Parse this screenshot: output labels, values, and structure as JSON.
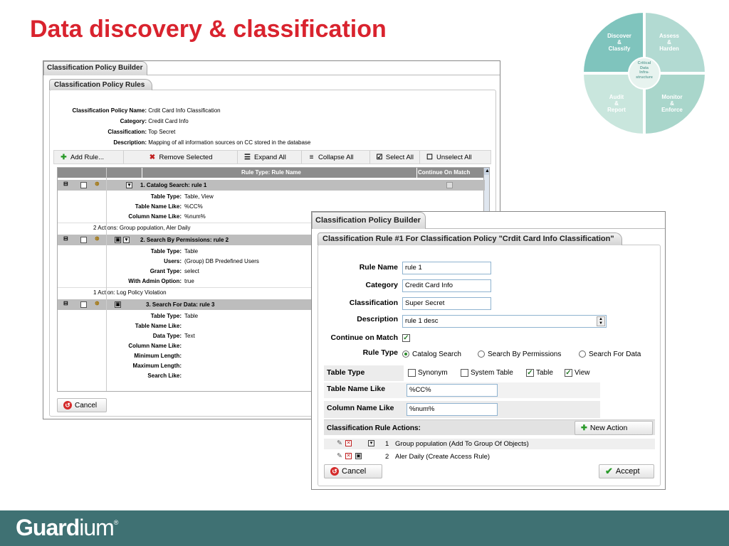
{
  "slide": {
    "title": "Data discovery & classification",
    "brand": {
      "strong": "Guard",
      "light": "ium",
      "mark": "®"
    }
  },
  "wheel": {
    "q1": [
      "Discover",
      "&",
      "Classify"
    ],
    "q2": [
      "Assess",
      "&",
      "Harden"
    ],
    "q3": [
      "Audit",
      "&",
      "Report"
    ],
    "q4": [
      "Monitor",
      "&",
      "Enforce"
    ],
    "center": [
      "Critical",
      "Data",
      "Infra-",
      "structure"
    ]
  },
  "policy_builder": {
    "tab": "Classification Policy Builder",
    "panel_tab": "Classification Policy Rules",
    "fields": [
      {
        "label": "Classification Policy Name:",
        "value": "Crdit Card Info Classification"
      },
      {
        "label": "Category:",
        "value": "Credit Card Info"
      },
      {
        "label": "Classification:",
        "value": "Top Secret"
      },
      {
        "label": "Description:",
        "value": "Mapping of all information sources on CC stored in the database"
      }
    ],
    "toolbar": {
      "add_rule": "Add Rule...",
      "remove_selected": "Remove Selected",
      "expand_all": "Expand All",
      "collapse_all": "Collapse All",
      "select_all": "Select All",
      "unselect_all": "Unselect All"
    },
    "grid": {
      "col_rule": "Rule Type: Rule Name",
      "col_continue": "Continue On Match"
    },
    "rules": [
      {
        "title": "1.  Catalog Search: rule 1",
        "details": [
          {
            "label": "Table Type:",
            "value": "Table, View"
          },
          {
            "label": "Table Name Like:",
            "value": "%CC%"
          },
          {
            "label": "Column Name Like:",
            "value": "%num%"
          }
        ],
        "actions": "2 Actions: Group population, Aler Daily"
      },
      {
        "title": "2.  Search By Permissions: rule 2",
        "details": [
          {
            "label": "Table Type:",
            "value": "Table"
          },
          {
            "label": "Users:",
            "value": "(Group) DB Predefined Users"
          },
          {
            "label": "Grant Type:",
            "value": "select"
          },
          {
            "label": "With Admin Option:",
            "value": "true"
          }
        ],
        "actions": "1 Action: Log Policy Violation"
      },
      {
        "title": "3.  Search For Data: rule 3",
        "details": [
          {
            "label": "Table Type:",
            "value": "Table"
          },
          {
            "label": "Table Name Like:",
            "value": ""
          },
          {
            "label": "Data Type:",
            "value": "Text"
          },
          {
            "label": "Column Name Like:",
            "value": ""
          },
          {
            "label": "Minimum Length:",
            "value": ""
          },
          {
            "label": "Maximum Length:",
            "value": ""
          },
          {
            "label": "Search Like:",
            "value": ""
          }
        ]
      }
    ],
    "cancel": "Cancel"
  },
  "rule_editor": {
    "tab": "Classification Policy Builder",
    "panel_tab": "Classification Rule #1 For Classification Policy \"Crdit Card Info Classification\"",
    "rule_name_label": "Rule Name",
    "rule_name": "rule 1",
    "category_label": "Category",
    "category": "Credit Card Info",
    "classification_label": "Classification",
    "classification": "Super Secret",
    "description_label": "Description",
    "description": "rule 1 desc",
    "continue_label": "Continue on Match",
    "continue_checked": true,
    "rule_type_label": "Rule Type",
    "rule_types": [
      "Catalog Search",
      "Search By Permissions",
      "Search For Data"
    ],
    "rule_type_selected": "Catalog Search",
    "table_type_label": "Table Type",
    "table_types": [
      {
        "label": "Synonym",
        "checked": false
      },
      {
        "label": "System Table",
        "checked": false
      },
      {
        "label": "Table",
        "checked": true
      },
      {
        "label": "View",
        "checked": true
      }
    ],
    "table_name_like_label": "Table Name Like",
    "table_name_like": "%CC%",
    "column_name_like_label": "Column Name Like",
    "column_name_like": "%num%",
    "actions_label": "Classification Rule Actions:",
    "new_action": "New Action",
    "actions": [
      {
        "num": "1",
        "text": "Group population  (Add To Group Of Objects)"
      },
      {
        "num": "2",
        "text": "Aler Daily  (Create Access Rule)"
      }
    ],
    "cancel": "Cancel",
    "accept": "Accept"
  },
  "colors": {
    "title": "#d9232e",
    "footer": "#3f7173",
    "grid_header": "#8c8c8c",
    "row_header": "#bdbdbd",
    "accent_green": "#2a8a2a"
  }
}
